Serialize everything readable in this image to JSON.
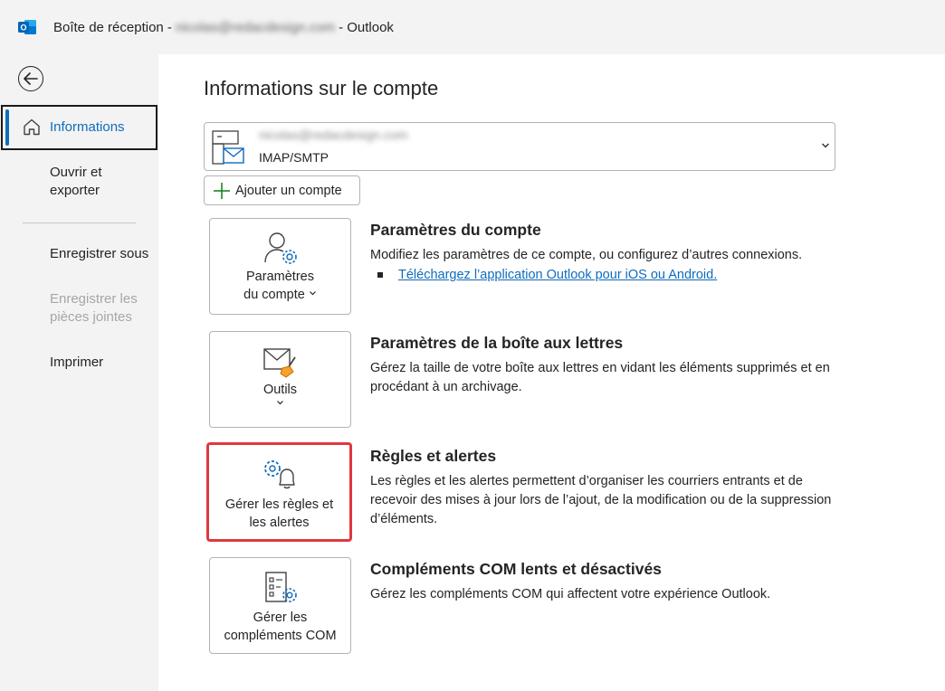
{
  "window": {
    "title_prefix": "Boîte de réception -",
    "title_email": "nicolas@redacdesign.com",
    "title_suffix": "-  Outlook",
    "logo_letter": "O"
  },
  "nav": {
    "items": [
      {
        "label": "Informations"
      },
      {
        "label": "Ouvrir et exporter"
      },
      {
        "label": "Enregistrer sous"
      },
      {
        "label": "Enregistrer les pièces jointes"
      },
      {
        "label": "Imprimer"
      }
    ]
  },
  "main": {
    "title": "Informations sur le compte",
    "account": {
      "email": "nicolas@redacdesign.com",
      "type": "IMAP/SMTP"
    },
    "add_account_label": "Ajouter un compte",
    "tiles": [
      {
        "label_1": "Paramètres",
        "label_2": "du compte"
      },
      {
        "label_1": "Outils"
      },
      {
        "label_1": "Gérer les règles et",
        "label_2": "les alertes"
      },
      {
        "label_1": "Gérer les",
        "label_2": "compléments COM"
      }
    ],
    "sections": [
      {
        "title": "Paramètres du compte",
        "text": "Modifiez les paramètres de ce compte, ou configurez d’autres connexions.",
        "link": "Téléchargez l’application Outlook pour iOS ou Android."
      },
      {
        "title": "Paramètres de la boîte aux lettres",
        "text": "Gérez la taille de votre boîte aux lettres en vidant les éléments supprimés et en procédant à un archivage."
      },
      {
        "title": "Règles et alertes",
        "text": "Les règles et les alertes permettent d’organiser les courriers entrants et de recevoir des mises à jour lors de l’ajout, de la modification ou de la suppression d’éléments."
      },
      {
        "title": "Compléments COM lents et désactivés",
        "text": "Gérez les compléments COM qui affectent votre expérience Outlook."
      }
    ]
  },
  "colors": {
    "accent": "#0f6cbd",
    "highlight": "#e0383e"
  }
}
